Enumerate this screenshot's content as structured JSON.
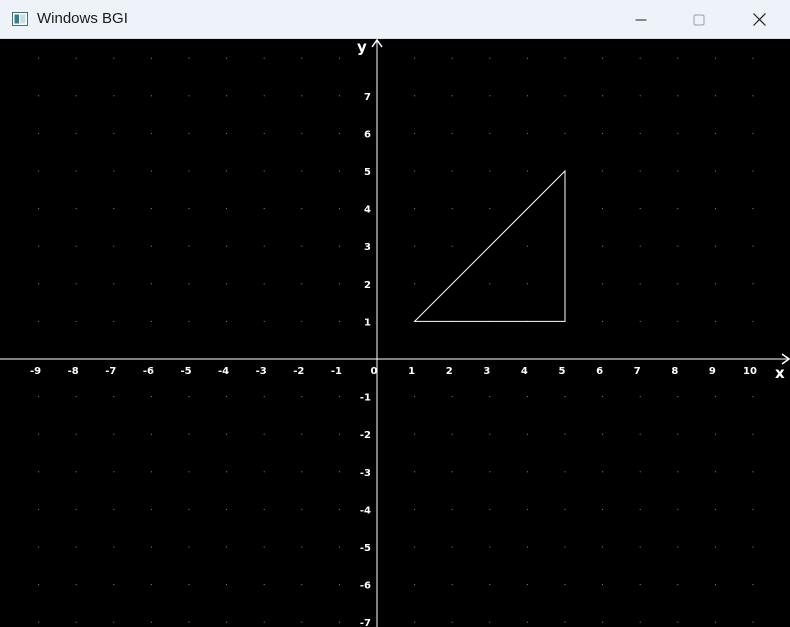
{
  "window": {
    "title": "Windows BGI",
    "icon": "bgi-app-icon",
    "controls": [
      "minimize-icon",
      "maximize-icon",
      "close-icon"
    ]
  },
  "plot": {
    "background": "#000000",
    "foreground": "#ffffff",
    "grid_dot_color": "#8a8a8a",
    "x_axis_label": "x",
    "y_axis_label": "y",
    "x_ticks": [
      "-9",
      "-8",
      "-7",
      "-6",
      "-5",
      "-4",
      "-3",
      "-2",
      "-1",
      "0",
      "1",
      "2",
      "3",
      "4",
      "5",
      "6",
      "7",
      "8",
      "9",
      "10"
    ],
    "y_ticks": [
      "7",
      "6",
      "5",
      "4",
      "3",
      "2",
      "1",
      "-1",
      "-2",
      "-3",
      "-4",
      "-5",
      "-6",
      "-7"
    ],
    "x_range": [
      -10,
      11
    ],
    "y_range": [
      -7,
      8
    ],
    "triangle": [
      [
        1,
        1
      ],
      [
        5,
        1
      ],
      [
        5,
        5
      ]
    ]
  }
}
